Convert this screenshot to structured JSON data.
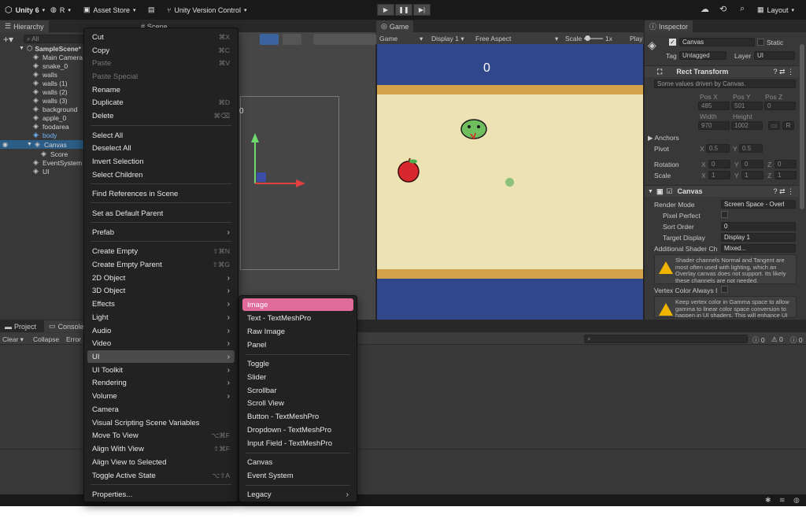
{
  "topbar": {
    "app": "Unity 6",
    "account": "R",
    "asset_store": "Asset Store",
    "version_control": "Unity Version Control",
    "layout": "Layout"
  },
  "hierarchy": {
    "tab": "Hierarchy",
    "search_placeholder": "All",
    "scene": "SampleScene*",
    "items": [
      "Main Camera",
      "snake_0",
      "walls",
      "walls (1)",
      "walls (2)",
      "walls (3)",
      "background",
      "apple_0",
      "foodarea",
      "body",
      "Canvas",
      "Score",
      "EventSystem",
      "UI"
    ]
  },
  "scene_tab": "Scene",
  "scene_label": "0",
  "game": {
    "tab": "Game",
    "mode": "Game",
    "display": "Display 1",
    "aspect": "Free Aspect",
    "scale_label": "Scale",
    "scale_value": "1x",
    "play": "Play",
    "score": "0",
    "colors": {
      "sky": "#30478b",
      "stripe": "#d4a24a",
      "field": "#ece2b4"
    }
  },
  "inspector": {
    "tab": "Inspector",
    "object_name": "Canvas",
    "static_label": "Static",
    "tag_label": "Tag",
    "tag_value": "Untagged",
    "layer_label": "Layer",
    "layer_value": "UI",
    "rect_transform": "Rect Transform",
    "rect_note": "Some values driven by Canvas.",
    "pos_x_label": "Pos X",
    "pos_y_label": "Pos Y",
    "pos_z_label": "Pos Z",
    "pos_x": "485",
    "pos_y": "501",
    "pos_z": "0",
    "width_label": "Width",
    "height_label": "Height",
    "width": "970",
    "height": "1002",
    "r_button": "R",
    "anchors": "Anchors",
    "pivot_label": "Pivot",
    "pivot_x": "0.5",
    "pivot_y": "0.5",
    "rotation_label": "Rotation",
    "rot_x": "0",
    "rot_y": "0",
    "rot_z": "0",
    "scale_label": "Scale",
    "scale_x": "1",
    "scale_y": "1",
    "scale_z": "1",
    "axis_x": "X",
    "axis_y": "Y",
    "axis_z": "Z",
    "canvas_header": "Canvas",
    "render_mode_label": "Render Mode",
    "render_mode_value": "Screen Space - Overl",
    "pixel_perfect_label": "Pixel Perfect",
    "sort_order_label": "Sort Order",
    "sort_order_value": "0",
    "target_display_label": "Target Display",
    "target_display_value": "Display 1",
    "shader_ch_label": "Additional Shader Ch",
    "shader_ch_value": "Mixed...",
    "warning1": "Shader channels Normal and Tangent are most often used with lighting, which an Overlay canvas does not support. Its likely these channels are not needed.",
    "vertex_label": "Vertex Color Always I",
    "warning2": "Keep vertex color in Gamma space to allow gamma to linear color space conversion to happen in UI shaders. This will enhance UI"
  },
  "bottom": {
    "tab_project": "Project",
    "tab_console": "Console",
    "clear": "Clear",
    "collapse": "Collapse",
    "error_pause": "Error",
    "count_info": "0",
    "count_warn": "0",
    "count_err": "0"
  },
  "context_menu": [
    {
      "label": "Cut",
      "shortcut": "⌘X"
    },
    {
      "label": "Copy",
      "shortcut": "⌘C"
    },
    {
      "label": "Paste",
      "shortcut": "⌘V",
      "disabled": true
    },
    {
      "label": "Paste Special",
      "disabled": true
    },
    {
      "label": "Rename"
    },
    {
      "label": "Duplicate",
      "shortcut": "⌘D"
    },
    {
      "label": "Delete",
      "shortcut": "⌘⌫"
    },
    {
      "label": "Select All"
    },
    {
      "label": "Deselect All"
    },
    {
      "label": "Invert Selection"
    },
    {
      "label": "Select Children"
    },
    {
      "label": "Find References in Scene"
    },
    {
      "label": "Set as Default Parent"
    },
    {
      "label": "Prefab",
      "submenu": true
    },
    {
      "label": "Create Empty",
      "shortcut": "⇧⌘N"
    },
    {
      "label": "Create Empty Parent",
      "shortcut": "⇧⌘G"
    },
    {
      "label": "2D Object",
      "submenu": true
    },
    {
      "label": "3D Object",
      "submenu": true
    },
    {
      "label": "Effects",
      "submenu": true
    },
    {
      "label": "Light",
      "submenu": true
    },
    {
      "label": "Audio",
      "submenu": true
    },
    {
      "label": "Video",
      "submenu": true
    },
    {
      "label": "UI",
      "submenu": true,
      "selected": true
    },
    {
      "label": "UI Toolkit",
      "submenu": true
    },
    {
      "label": "Rendering",
      "submenu": true
    },
    {
      "label": "Volume",
      "submenu": true
    },
    {
      "label": "Camera"
    },
    {
      "label": "Visual Scripting Scene Variables"
    },
    {
      "label": "Move To View",
      "shortcut": "⌥⌘F"
    },
    {
      "label": "Align With View",
      "shortcut": "⇧⌘F"
    },
    {
      "label": "Align View to Selected"
    },
    {
      "label": "Toggle Active State",
      "shortcut": "⌥⇧A"
    },
    {
      "label": "Properties..."
    }
  ],
  "submenu": [
    {
      "label": "Image",
      "highlighted": true
    },
    {
      "label": "Text - TextMeshPro"
    },
    {
      "label": "Raw Image"
    },
    {
      "label": "Panel"
    },
    {
      "label": "Toggle"
    },
    {
      "label": "Slider"
    },
    {
      "label": "Scrollbar"
    },
    {
      "label": "Scroll View"
    },
    {
      "label": "Button - TextMeshPro"
    },
    {
      "label": "Dropdown - TextMeshPro"
    },
    {
      "label": "Input Field - TextMeshPro"
    },
    {
      "label": "Canvas"
    },
    {
      "label": "Event System"
    },
    {
      "label": "Legacy",
      "submenu": true
    }
  ]
}
